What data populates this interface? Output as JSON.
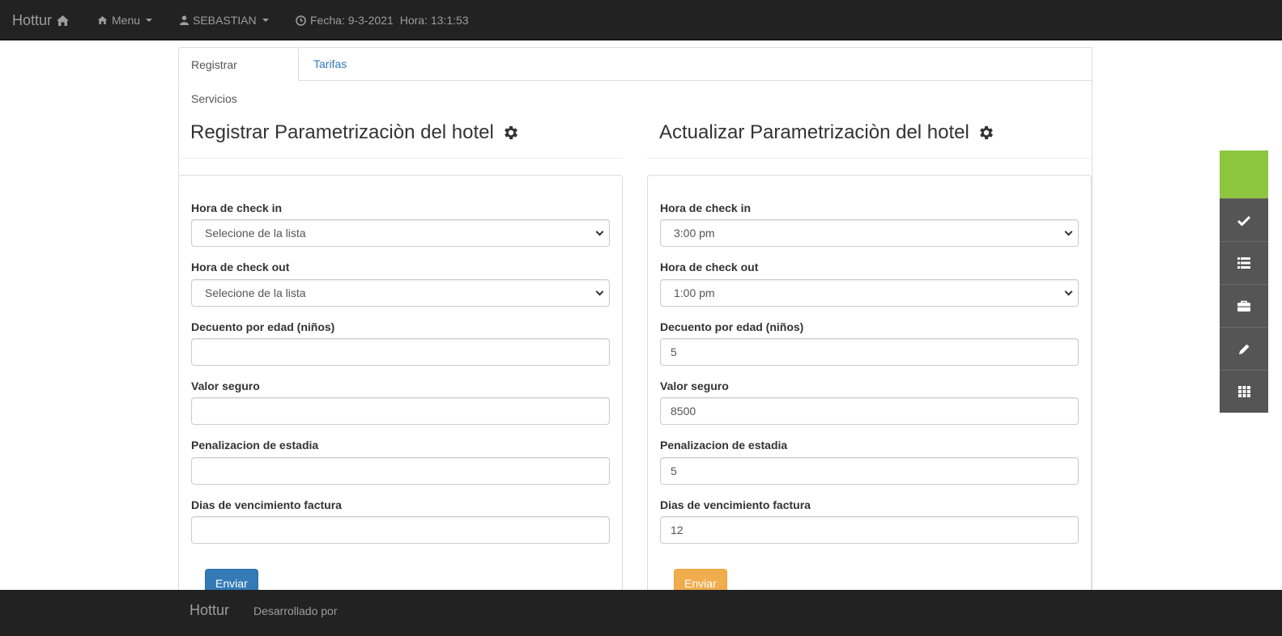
{
  "navbar": {
    "brand": "Hottur",
    "menu_label": "Menu",
    "user_label": "SEBASTIAN",
    "date_text": "Fecha: 9-3-2021",
    "time_text": "Hora: 13:1:53"
  },
  "tabs": [
    {
      "label": "Registrar Servicios",
      "active": true
    },
    {
      "label": "Tarifas",
      "active": false
    }
  ],
  "register_form": {
    "title": "Registrar Parametrizaciòn del hotel",
    "checkin_label": "Hora de check in",
    "checkin_value": "Selecione de la lista",
    "checkout_label": "Hora de check out",
    "checkout_value": "Selecione de la lista",
    "discount_label": "Decuento por edad (niños)",
    "discount_value": "",
    "insurance_label": "Valor seguro",
    "insurance_value": "",
    "penalty_label": "Penalizacion de estadia",
    "penalty_value": "",
    "due_days_label": "Dias de vencimiento factura",
    "due_days_value": "",
    "submit_label": "Enviar"
  },
  "update_form": {
    "title": "Actualizar Parametrizaciòn del hotel",
    "checkin_label": "Hora de check in",
    "checkin_value": "3:00 pm",
    "checkout_label": "Hora de check out",
    "checkout_value": "1:00 pm",
    "discount_label": "Decuento por edad (niños)",
    "discount_value": "5",
    "insurance_label": "Valor seguro",
    "insurance_value": "8500",
    "penalty_label": "Penalizacion de estadia",
    "penalty_value": "5",
    "due_days_label": "Dias de vencimiento factura",
    "due_days_value": "12",
    "submit_label": "Enviar"
  },
  "footer": {
    "brand": "Hottur",
    "text": "Desarrollado por"
  },
  "side_toolbar": {
    "icons": [
      "check-icon",
      "list-icon",
      "briefcase-icon",
      "pencil-icon",
      "grid-icon"
    ]
  },
  "colors": {
    "navbar_bg": "#222222",
    "primary": "#337ab7",
    "warning": "#f0ad4e",
    "side_accent": "#8cc63f",
    "side_bg": "#555555"
  }
}
